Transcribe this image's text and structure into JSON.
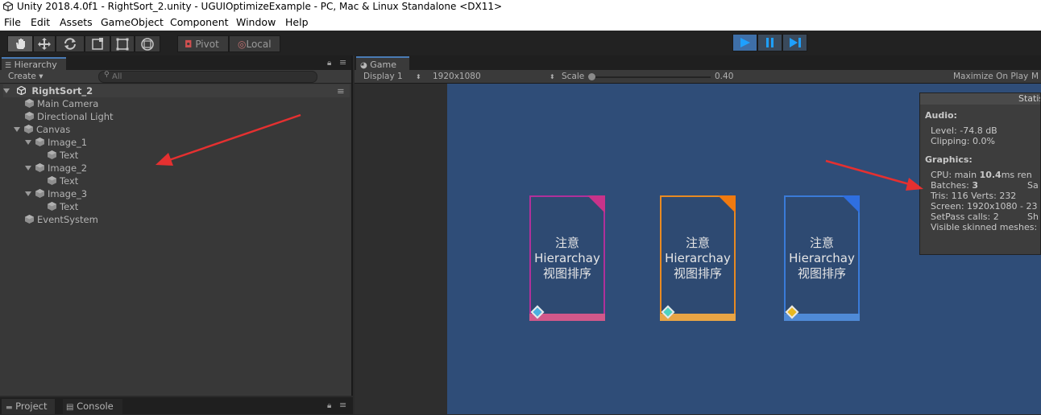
{
  "window": {
    "title": "Unity 2018.4.0f1 - RightSort_2.unity - UGUIOptimizeExample - PC, Mac & Linux Standalone <DX11>"
  },
  "menu": [
    "File",
    "Edit",
    "Assets",
    "GameObject",
    "Component",
    "Window",
    "Help"
  ],
  "toolbar": {
    "tools": [
      "hand-tool-icon",
      "move-tool-icon",
      "rotate-tool-icon",
      "scale-tool-icon",
      "rect-tool-icon",
      "transform-tool-icon"
    ],
    "pivot_label": "Pivot",
    "local_label": "Local",
    "play_controls": [
      "play-icon",
      "pause-icon",
      "step-icon"
    ]
  },
  "hierarchy": {
    "tab_label": "Hierarchy",
    "create_label": "Create ▾",
    "search_placeholder": "All",
    "scene_name": "RightSort_2",
    "items": [
      {
        "label": "Main Camera"
      },
      {
        "label": "Directional Light"
      },
      {
        "label": "Canvas"
      },
      {
        "label": "Image_1"
      },
      {
        "label": "Text"
      },
      {
        "label": "Image_2"
      },
      {
        "label": "Text"
      },
      {
        "label": "Image_3"
      },
      {
        "label": "Text"
      },
      {
        "label": "EventSystem"
      }
    ]
  },
  "bottom_tabs": {
    "project": "Project",
    "console": "Console"
  },
  "game": {
    "tab_label": "Game",
    "display": "Display 1",
    "resolution": "1920x1080",
    "scale_label": "Scale",
    "scale_value": "0.40",
    "maximize": "Maximize On Play",
    "cards": [
      {
        "line1": "注意",
        "line2": "Hierarchay",
        "line3": "视图排序",
        "color": "#b0309a",
        "accent": "#c8338a",
        "bottom": "#d2588a"
      },
      {
        "line1": "注意",
        "line2": "Hierarchay",
        "line3": "视图排序",
        "color": "#e88a22",
        "accent": "#f07a10",
        "bottom": "#e9a545"
      },
      {
        "line1": "注意",
        "line2": "Hierarchay",
        "line3": "视图排序",
        "color": "#3a7bd8",
        "accent": "#2f6fe0",
        "bottom": "#4f8ad6"
      }
    ]
  },
  "stats": {
    "title": "Statis",
    "audio_header": "Audio:",
    "level": "Level: -74.8 dB",
    "clipping": "Clipping: 0.0%",
    "graphics_header": "Graphics:",
    "cpu_prefix": "CPU: main ",
    "cpu_value": "10.4",
    "cpu_suffix": "ms  ren",
    "batches_prefix": "Batches: ",
    "batches_value": "3",
    "batches_suffix": "Sa",
    "tris": "Tris: 116  Verts: 232",
    "screen": "Screen: 1920x1080 - 23",
    "setpass": "SetPass calls: 2",
    "setpass_suffix": "Sh",
    "skinned": "Visible skinned meshes:"
  }
}
